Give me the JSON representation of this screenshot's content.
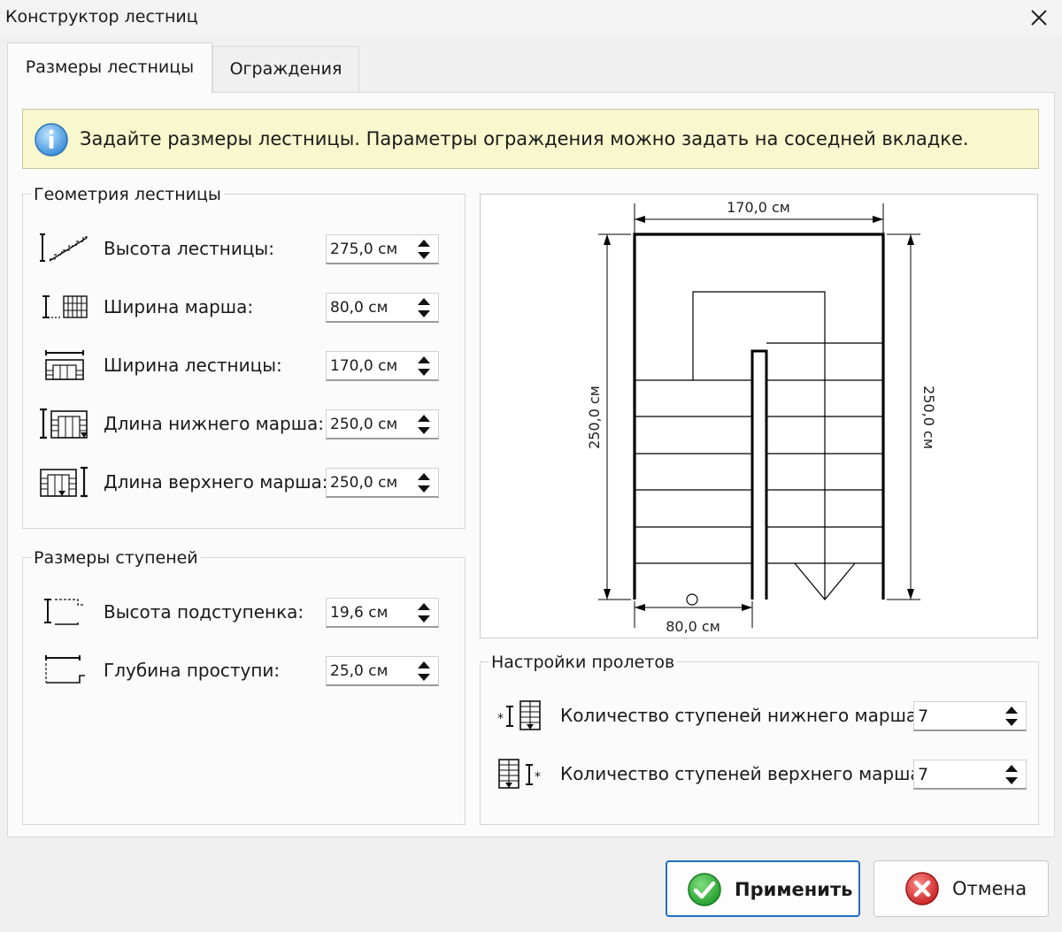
{
  "window": {
    "title": "Конструктор лестниц"
  },
  "tabs": [
    {
      "label": "Размеры лестницы",
      "active": true
    },
    {
      "label": "Ограждения",
      "active": false
    }
  ],
  "info": {
    "text": "Задайте размеры лестницы. Параметры ограждения можно задать на соседней вкладке.",
    "icon": "info-icon"
  },
  "geometry": {
    "title": "Геометрия лестницы",
    "fields": [
      {
        "label": "Высота лестницы:",
        "value": "275,0 см",
        "icon": "stair-height-icon"
      },
      {
        "label": "Ширина марша:",
        "value": "80,0 см",
        "icon": "flight-width-icon"
      },
      {
        "label": "Ширина лестницы:",
        "value": "170,0 см",
        "icon": "stair-width-icon"
      },
      {
        "label": "Длина нижнего марша:",
        "value": "250,0 см",
        "icon": "lower-flight-length-icon"
      },
      {
        "label": "Длина верхнего марша:",
        "value": "250,0 см",
        "icon": "upper-flight-length-icon"
      }
    ]
  },
  "steps": {
    "title": "Размеры ступеней",
    "fields": [
      {
        "label": "Высота подступенка:",
        "value": "19,6 см",
        "icon": "riser-height-icon"
      },
      {
        "label": "Глубина проступи:",
        "value": "25,0 см",
        "icon": "tread-depth-icon"
      }
    ]
  },
  "flights": {
    "title": "Настройки пролетов",
    "fields": [
      {
        "label": "Количество ступеней нижнего марша:",
        "value": "7",
        "icon": "lower-steps-count-icon"
      },
      {
        "label": "Количество ступеней верхнего марша:",
        "value": "7",
        "icon": "upper-steps-count-icon"
      }
    ]
  },
  "diagram": {
    "width_label": "170,0 см",
    "left_length_label": "250,0 см",
    "right_length_label": "250,0 см",
    "flight_width_label": "80,0 см"
  },
  "buttons": {
    "apply": "Применить",
    "cancel": "Отмена"
  },
  "colors": {
    "accent": "#1f6fc2",
    "info_bg": "#f8f7cd",
    "ok": "#2aa52a",
    "cancel": "#d42a2a"
  }
}
